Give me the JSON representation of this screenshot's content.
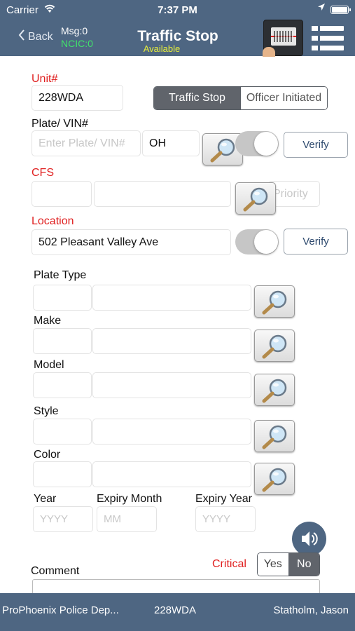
{
  "status_bar": {
    "carrier": "Carrier",
    "time": "7:37 PM"
  },
  "nav": {
    "back_label": "Back",
    "msg": "Msg:0",
    "ncic": "NCIC:0",
    "title": "Traffic Stop",
    "status": "Available"
  },
  "form": {
    "unit_label": "Unit#",
    "unit_value": "228WDA",
    "stop_type_options": [
      "Traffic Stop",
      "Officer Initiated"
    ],
    "stop_type_selected": "Traffic Stop",
    "plate_label": "Plate/ VIN#",
    "plate_placeholder": "Enter Plate/ VIN#",
    "plate_state": "OH",
    "verify_label": "Verify",
    "cfs_label": "CFS",
    "priority_placeholder": "Priority",
    "location_label": "Location",
    "location_value": "502 Pleasant Valley Ave",
    "plate_type_label": "Plate Type",
    "make_label": "Make",
    "model_label": "Model",
    "style_label": "Style",
    "color_label": "Color",
    "year_label": "Year",
    "expiry_month_label": "Expiry Month",
    "expiry_year_label": "Expiry Year",
    "year_placeholder": "YYYY",
    "month_placeholder": "MM",
    "expiry_year_placeholder": "YYYY",
    "comment_label": "Comment",
    "critical_label": "Critical",
    "critical_options": [
      "Yes",
      "No"
    ],
    "critical_selected": "No"
  },
  "bottom_bar": {
    "department": "ProPhoenix Police Dep...",
    "unit": "228WDA",
    "officer": "Statholm, Jason"
  },
  "colors": {
    "bar": "#4e6682",
    "required_label": "#e02020",
    "ncic": "#41e26b",
    "available": "#e8ef3a"
  },
  "icons": [
    "back-chevron-icon",
    "wifi-icon",
    "location-arrow-icon",
    "battery-icon",
    "barcode-scanner-icon",
    "menu-icon",
    "magnifier-icon",
    "speaker-icon"
  ]
}
